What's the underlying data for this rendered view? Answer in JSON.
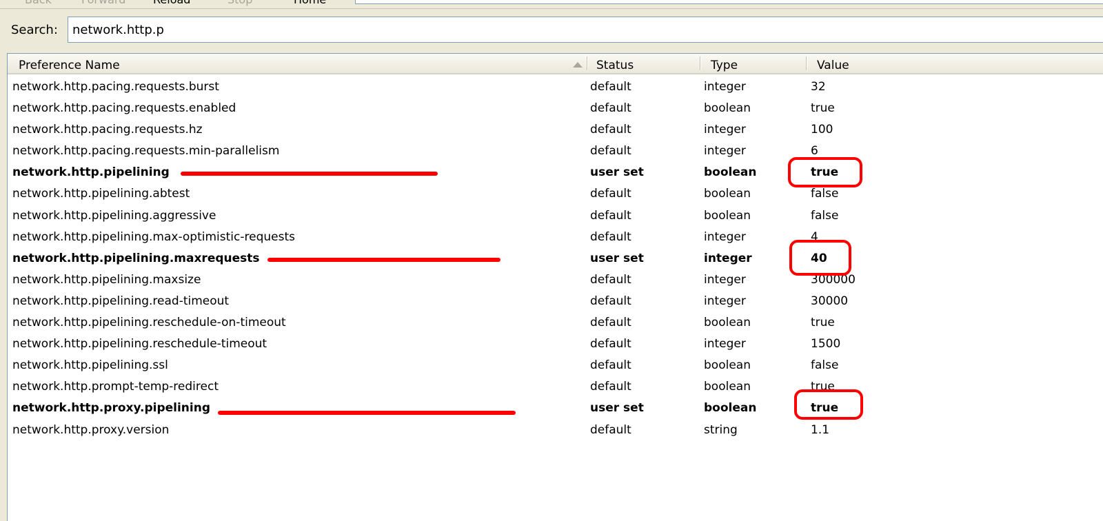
{
  "toolbar": {
    "back": "Back",
    "forward": "Forward",
    "reload": "Reload",
    "stop": "Stop",
    "home": "Home"
  },
  "search": {
    "label": "Search:",
    "value": "network.http.p"
  },
  "columns": {
    "name": "Preference Name",
    "status": "Status",
    "type": "Type",
    "value": "Value"
  },
  "rows": [
    {
      "name": "network.http.pacing.requests.burst",
      "status": "default",
      "type": "integer",
      "value": "32"
    },
    {
      "name": "network.http.pacing.requests.enabled",
      "status": "default",
      "type": "boolean",
      "value": "true"
    },
    {
      "name": "network.http.pacing.requests.hz",
      "status": "default",
      "type": "integer",
      "value": "100"
    },
    {
      "name": "network.http.pacing.requests.min-parallelism",
      "status": "default",
      "type": "integer",
      "value": "6"
    },
    {
      "name": "network.http.pipelining",
      "status": "user set",
      "type": "boolean",
      "value": "true"
    },
    {
      "name": "network.http.pipelining.abtest",
      "status": "default",
      "type": "boolean",
      "value": "false"
    },
    {
      "name": "network.http.pipelining.aggressive",
      "status": "default",
      "type": "boolean",
      "value": "false"
    },
    {
      "name": "network.http.pipelining.max-optimistic-requests",
      "status": "default",
      "type": "integer",
      "value": "4"
    },
    {
      "name": "network.http.pipelining.maxrequests",
      "status": "user set",
      "type": "integer",
      "value": "40"
    },
    {
      "name": "network.http.pipelining.maxsize",
      "status": "default",
      "type": "integer",
      "value": "300000"
    },
    {
      "name": "network.http.pipelining.read-timeout",
      "status": "default",
      "type": "integer",
      "value": "30000"
    },
    {
      "name": "network.http.pipelining.reschedule-on-timeout",
      "status": "default",
      "type": "boolean",
      "value": "true"
    },
    {
      "name": "network.http.pipelining.reschedule-timeout",
      "status": "default",
      "type": "integer",
      "value": "1500"
    },
    {
      "name": "network.http.pipelining.ssl",
      "status": "default",
      "type": "boolean",
      "value": "false"
    },
    {
      "name": "network.http.prompt-temp-redirect",
      "status": "default",
      "type": "boolean",
      "value": "true"
    },
    {
      "name": "network.http.proxy.pipelining",
      "status": "user set",
      "type": "boolean",
      "value": "true"
    },
    {
      "name": "network.http.proxy.version",
      "status": "default",
      "type": "string",
      "value": "1.1"
    }
  ],
  "colors": {
    "annotation": "#ff0000",
    "panel_border": "#7f9db9",
    "chrome": "#ece9d8"
  }
}
